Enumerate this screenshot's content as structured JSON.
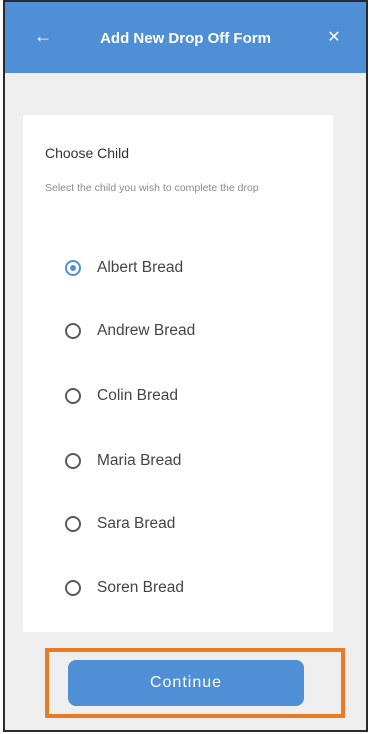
{
  "header": {
    "title": "Add New Drop Off Form",
    "back_icon": "←",
    "close_icon": "✕"
  },
  "form": {
    "heading": "Choose Child",
    "subtext": "Select the child you wish to complete the drop",
    "children": [
      {
        "name": "Albert Bread",
        "selected": true
      },
      {
        "name": "Andrew Bread",
        "selected": false
      },
      {
        "name": "Colin Bread",
        "selected": false
      },
      {
        "name": "Maria Bread",
        "selected": false
      },
      {
        "name": "Sara Bread",
        "selected": false
      },
      {
        "name": "Soren Bread",
        "selected": false
      }
    ]
  },
  "footer": {
    "continue_label": "Continue"
  },
  "colors": {
    "accent": "#4f8fd6",
    "highlight": "#ea7b23"
  }
}
